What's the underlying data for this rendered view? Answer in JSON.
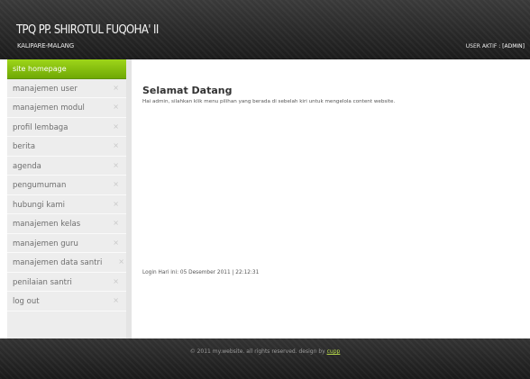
{
  "header": {
    "site_title": "TPQ PP. SHIROTUL FUQOHA' II",
    "site_subtitle": "KALIPARE-MALANG",
    "user_label": "USER AKTIF : ",
    "user_name": "[ADMIN]"
  },
  "sidebar": {
    "items": [
      {
        "label": "site homepage"
      },
      {
        "label": "manajemen user"
      },
      {
        "label": "manajemen modul"
      },
      {
        "label": "profil lembaga"
      },
      {
        "label": "berita"
      },
      {
        "label": "agenda"
      },
      {
        "label": "pengumuman"
      },
      {
        "label": "hubungi kami"
      },
      {
        "label": "manajemen kelas"
      },
      {
        "label": "manajemen guru"
      },
      {
        "label": "manajemen data santri"
      },
      {
        "label": "penilaian santri"
      },
      {
        "label": "log out"
      }
    ],
    "close_glyph": "×"
  },
  "main": {
    "title": "Selamat Datang",
    "welcome_text": "Hai admin, silahkan klik menu pilihan yang berada di sebelah kiri untuk mengelola content website.",
    "login_info": "Login Hari ini: 05 Desember 2011 | 22:12:31"
  },
  "footer": {
    "text": "© 2011 my.website. all rights reserved. design by ",
    "link_text": "cupp"
  },
  "colors": {
    "accent_green": "#8cc412",
    "header_bg": "#262626",
    "sidebar_bg": "#ededed"
  }
}
